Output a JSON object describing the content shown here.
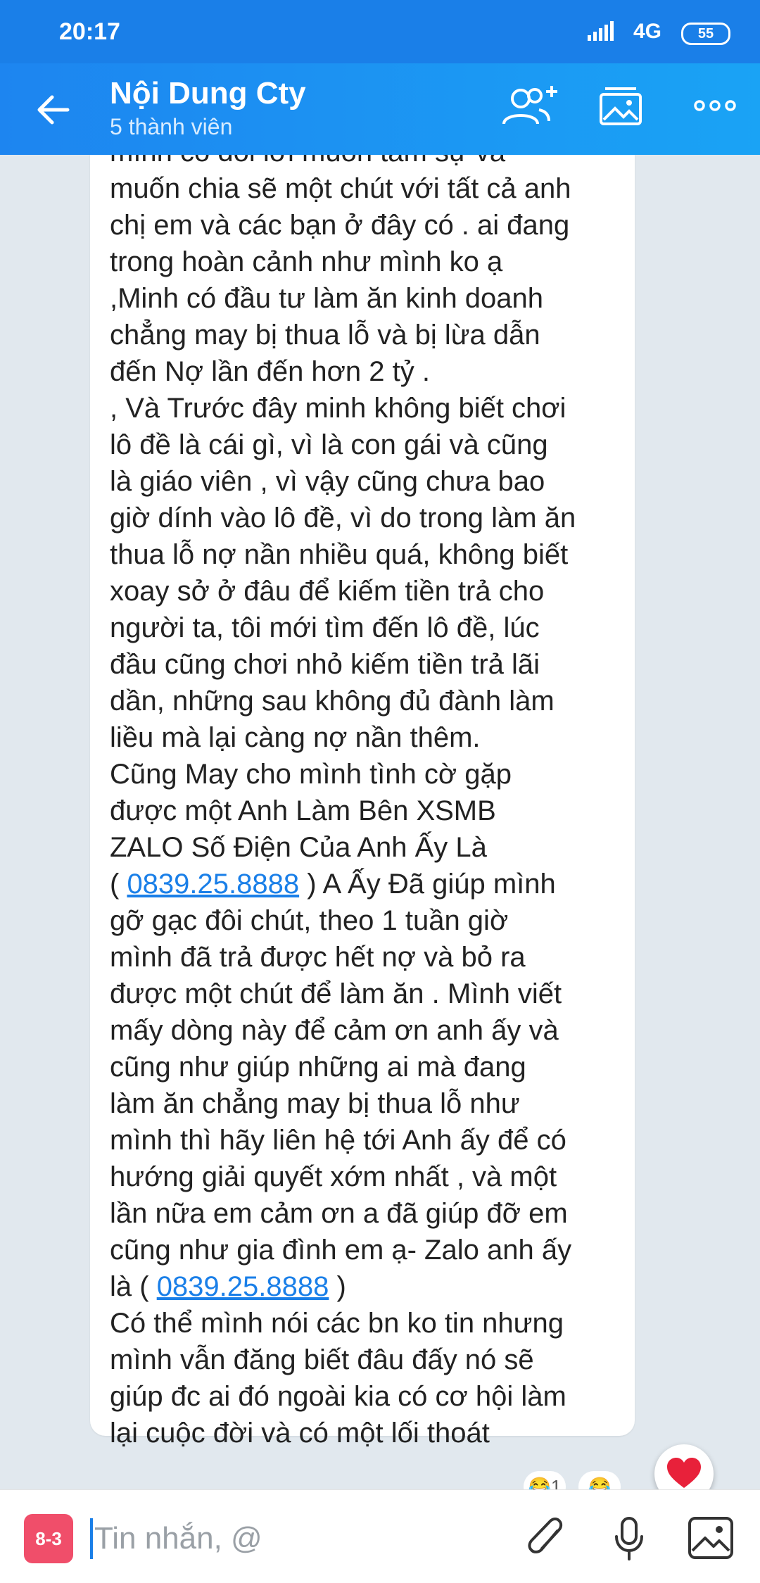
{
  "statusbar": {
    "time": "20:17",
    "network": "4G",
    "battery": "55"
  },
  "header": {
    "title": "Nội Dung Cty",
    "subtitle": "5 thành viên",
    "icons": [
      "back-arrow-icon",
      "add-member-icon",
      "media-gallery-icon",
      "more-icon"
    ]
  },
  "message": {
    "lines": [
      "mình có đôi lời muốn tâm sự và",
      "muốn chia sẽ một chút với tất cả anh",
      "chị em và các bạn ở đây có . ai đang",
      "trong hoàn cảnh như mình ko ạ",
      ",Minh có đầu tư làm ăn kinh doanh",
      "chẳng may bị thua lỗ và bị lừa dẫn",
      "đến Nợ lần đến hơn 2 tỷ .",
      ", Và Trước đây minh không biết chơi",
      "lô đề là cái gì, vì là con gái và cũng",
      "là giáo viên , vì vậy cũng chưa bao",
      "giờ dính vào lô đề, vì do trong làm ăn",
      "thua lỗ nợ nần nhiều quá, không biết",
      "xoay sở ở đâu để kiếm tiền trả cho",
      "người ta, tôi mới tìm đến lô đề, lúc",
      "đầu cũng chơi nhỏ kiếm tiền trả lãi",
      "dần, những sau không đủ đành làm",
      "liều mà lại càng nợ nần thêm.",
      "Cũng May cho mình tình cờ gặp",
      "được một Anh Làm Bên XSMB",
      "ZALO Số Điện Của Anh Ấy Là"
    ],
    "phone_line_1": {
      "prefix": "( ",
      "phone": "0839.25.8888",
      "suffix": " ) A Ấy Đã giúp mình"
    },
    "lines_2": [
      "gỡ gạc đôi chút, theo 1 tuần giờ",
      "mình đã trả được hết nợ và bỏ ra",
      "được một chút để làm ăn . Mình viết",
      "mấy dòng này để cảm ơn anh ấy và",
      "cũng như giúp những ai mà đang",
      "làm ăn chẳng may bị thua lỗ như",
      "mình thì hãy liên hệ tới Anh ấy để có",
      "hướng giải quyết xớm nhất , và một",
      "lần nữa em cảm ơn a đã giúp đỡ em",
      "cũng như gia đình em ạ- Zalo anh ấy"
    ],
    "phone_line_2": {
      "prefix": "là ( ",
      "phone": "0839.25.8888",
      "suffix": " )"
    },
    "lines_3": [
      "Có thể mình nói các bn ko tin nhưng",
      "mình vẫn đăng biết đâu đấy nó sẽ",
      "giúp đc ai đó ngoài kia có cơ hội làm",
      "lại cuộc đời và có một lối thoát"
    ],
    "reaction_count": "1"
  },
  "input": {
    "placeholder": "Tin nhắn, @",
    "sticker_label": "8-3"
  },
  "colors": {
    "brand": "#1a7fe8",
    "link": "#1a7fe8",
    "heart": "#e8213a"
  }
}
